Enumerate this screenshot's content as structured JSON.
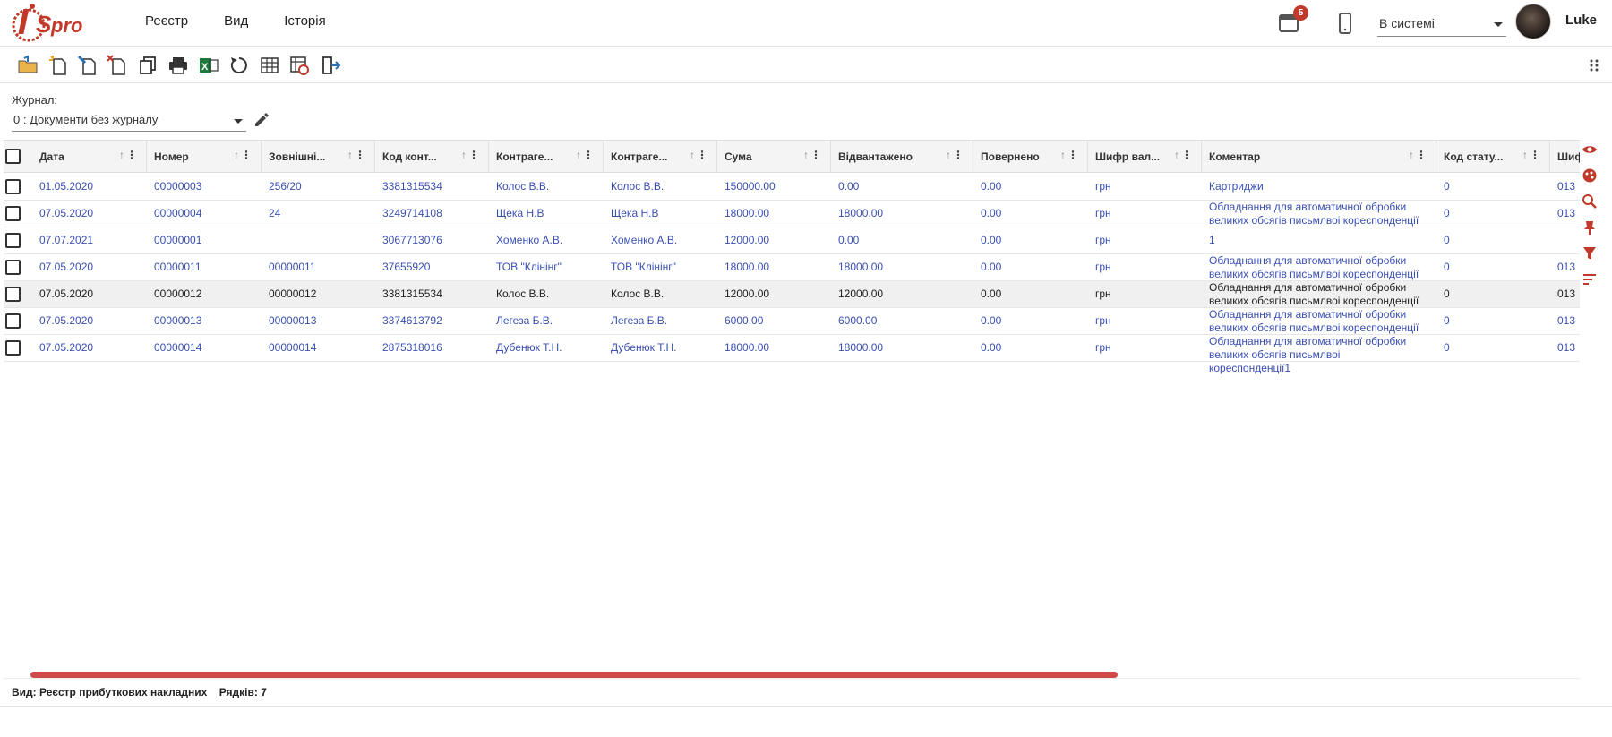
{
  "app": {
    "logo_text": "ISpro"
  },
  "menu": [
    "Реєстр",
    "Вид",
    "Історія"
  ],
  "header": {
    "notifications_count": "5",
    "status_value": "В системі",
    "username": "Luke"
  },
  "toolbar_icons": [
    "open-folder-icon",
    "add-document-icon",
    "edit-document-icon",
    "delete-document-icon",
    "copy-icon",
    "print-icon",
    "excel-export-icon",
    "refresh-icon",
    "table-view-icon",
    "settings-table-icon",
    "exit-icon"
  ],
  "journal": {
    "label": "Журнал:",
    "value": "0 : Документи без журналу"
  },
  "table": {
    "columns": [
      "Дата",
      "Номер",
      "Зовнішні...",
      "Код конт...",
      "Контраге...",
      "Контраге...",
      "Сума",
      "Відвантажено",
      "Повернено",
      "Шифр вал...",
      "Коментар",
      "Код стату...",
      "Шиф"
    ],
    "rows": [
      {
        "date": "01.05.2020",
        "num": "00000003",
        "ext": "256/20",
        "code": "3381315534",
        "c1": "Колос В.В.",
        "c2": "Колос В.В.",
        "sum": "150000.00",
        "ship": "0.00",
        "ret": "0.00",
        "cur": "грн",
        "comment": "Картриджи",
        "status": "0",
        "last": "013"
      },
      {
        "date": "07.05.2020",
        "num": "00000004",
        "ext": "24",
        "code": "3249714108",
        "c1": "Щека Н.В",
        "c2": "Щека Н.В",
        "sum": "18000.00",
        "ship": "18000.00",
        "ret": "0.00",
        "cur": "грн",
        "comment": "Обладнання для автоматичної обробки великих обсягів письмлвоі кореспонденції",
        "status": "0",
        "last": "013"
      },
      {
        "date": "07.07.2021",
        "num": "00000001",
        "ext": "",
        "code": "3067713076",
        "c1": "Хоменко А.В.",
        "c2": "Хоменко А.В.",
        "sum": "12000.00",
        "ship": "0.00",
        "ret": "0.00",
        "cur": "грн",
        "comment": "1",
        "status": "0",
        "last": ""
      },
      {
        "date": "07.05.2020",
        "num": "00000011",
        "ext": "00000011",
        "code": "37655920",
        "c1": "ТОВ \"Клінінг\"",
        "c2": "ТОВ \"Клінінг\"",
        "sum": "18000.00",
        "ship": "18000.00",
        "ret": "0.00",
        "cur": "грн",
        "comment": "Обладнання для автоматичної обробки великих обсягів письмлвоі кореспонденції",
        "status": "0",
        "last": "013"
      },
      {
        "date": "07.05.2020",
        "num": "00000012",
        "ext": "00000012",
        "code": "3381315534",
        "c1": "Колос В.В.",
        "c2": "Колос В.В.",
        "sum": "12000.00",
        "ship": "12000.00",
        "ret": "0.00",
        "cur": "грн",
        "comment": "Обладнання для автоматичної обробки великих обсягів письмлвоі кореспонденції",
        "status": "0",
        "last": "013"
      },
      {
        "date": "07.05.2020",
        "num": "00000013",
        "ext": "00000013",
        "code": "3374613792",
        "c1": "Легеза Б.В.",
        "c2": "Легеза Б.В.",
        "sum": "6000.00",
        "ship": "6000.00",
        "ret": "0.00",
        "cur": "грн",
        "comment": "Обладнання для автоматичної обробки великих обсягів письмлвоі кореспонденції",
        "status": "0",
        "last": "013"
      },
      {
        "date": "07.05.2020",
        "num": "00000014",
        "ext": "00000014",
        "code": "2875318016",
        "c1": "Дубенюк Т.Н.",
        "c2": "Дубенюк Т.Н.",
        "sum": "18000.00",
        "ship": "18000.00",
        "ret": "0.00",
        "cur": "грн",
        "comment": "Обладнання для автоматичної обробки великих обсягів письмлвоі кореспонденції1",
        "status": "0",
        "last": "013"
      }
    ]
  },
  "side_icons": [
    "eye-icon",
    "palette-icon",
    "search-icon",
    "pin-icon",
    "filter-icon",
    "sort-lines-icon"
  ],
  "footer": {
    "view_label": "Вид: Реєстр прибуткових накладних",
    "rows_label": "Рядків: 7"
  },
  "colors": {
    "accent": "#d14a4a",
    "link": "#3a4fb0"
  }
}
